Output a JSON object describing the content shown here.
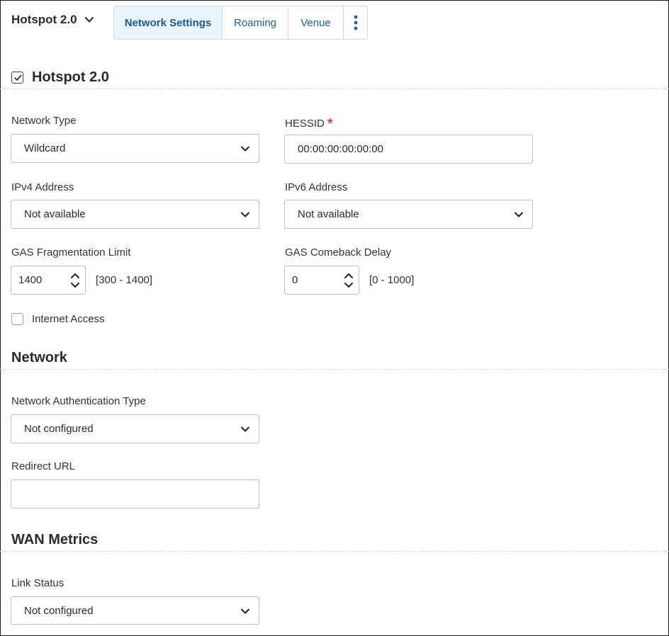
{
  "header": {
    "title": "Hotspot 2.0",
    "tabs": [
      {
        "label": "Network Settings",
        "active": true
      },
      {
        "label": "Roaming",
        "active": false
      },
      {
        "label": "Venue",
        "active": false
      }
    ],
    "more_icon": "vertical-ellipsis-icon"
  },
  "hotspot": {
    "section_title": "Hotspot 2.0",
    "enabled": true,
    "network_type": {
      "label": "Network Type",
      "value": "Wildcard"
    },
    "hessid": {
      "label": "HESSID",
      "required_mark": "*",
      "value": "00:00:00:00:00:00"
    },
    "ipv4": {
      "label": "IPv4 Address",
      "value": "Not available"
    },
    "ipv6": {
      "label": "IPv6 Address",
      "value": "Not available"
    },
    "gas_frag": {
      "label": "GAS Fragmentation Limit",
      "value": "1400",
      "range": "[300 - 1400]"
    },
    "gas_comeback": {
      "label": "GAS Comeback Delay",
      "value": "0",
      "range": "[0 - 1000]"
    },
    "internet_access": {
      "label": "Internet Access",
      "checked": false
    }
  },
  "network": {
    "section_title": "Network",
    "auth_type": {
      "label": "Network Authentication Type",
      "value": "Not configured"
    },
    "redirect_url": {
      "label": "Redirect URL",
      "value": ""
    }
  },
  "wan": {
    "section_title": "WAN Metrics",
    "link_status": {
      "label": "Link Status",
      "value": "Not configured"
    }
  },
  "colors": {
    "accent": "#1e5f9c",
    "active_tab_bg": "#eaf4fc",
    "required": "#d0021b"
  }
}
